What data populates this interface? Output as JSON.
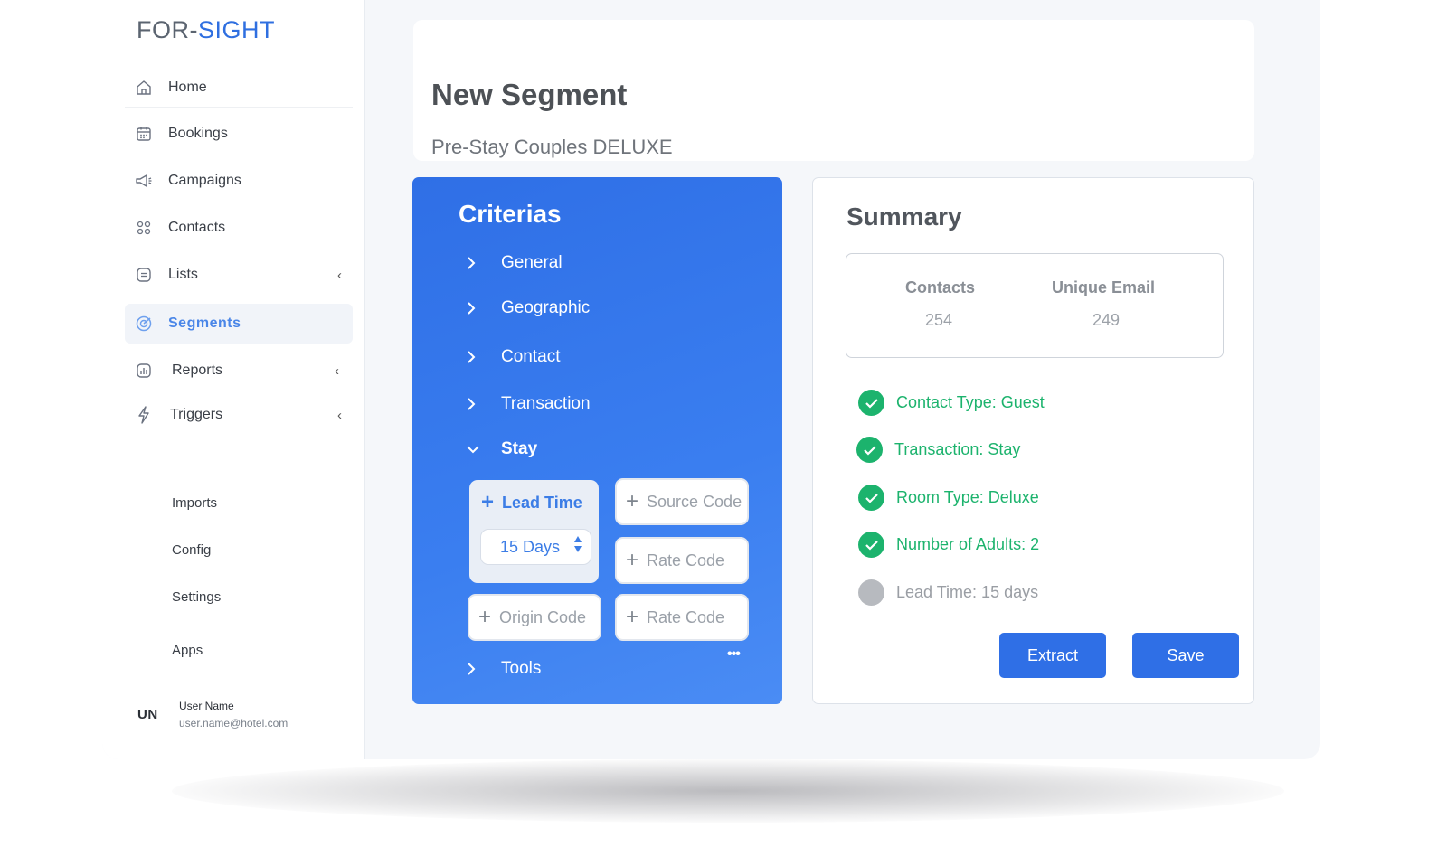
{
  "app": {
    "logo": {
      "part1": "FOR",
      "part2": "SIGHT"
    }
  },
  "sidebar": {
    "items": [
      {
        "label": "Home",
        "icon": "home-icon"
      },
      {
        "label": "Bookings",
        "icon": "calendar-icon"
      },
      {
        "label": "Campaigns",
        "icon": "megaphone-icon"
      },
      {
        "label": "Contacts",
        "icon": "people-icon"
      },
      {
        "label": "Lists",
        "icon": "list-icon",
        "caret": "‹"
      },
      {
        "label": "Segments",
        "icon": "target-icon",
        "active": true
      },
      {
        "label": "Reports",
        "icon": "chart-icon",
        "caret": "‹"
      },
      {
        "label": "Triggers",
        "icon": "lightning-icon",
        "caret": "‹"
      }
    ],
    "secondary": [
      "Imports",
      "Config",
      "Settings",
      "Apps"
    ],
    "user": {
      "initials": "UN",
      "name": "User Name",
      "email": "user.name@hotel.com"
    }
  },
  "header": {
    "title": "New Segment",
    "subtitle": "Pre-Stay Couples DELUXE"
  },
  "criterias": {
    "title": "Criterias",
    "sections": [
      {
        "label": "General",
        "expanded": false
      },
      {
        "label": "Geographic",
        "expanded": false
      },
      {
        "label": "Contact",
        "expanded": false
      },
      {
        "label": "Transaction",
        "expanded": false
      },
      {
        "label": "Stay",
        "expanded": true
      },
      {
        "label": "Tools",
        "expanded": false
      }
    ],
    "stay": {
      "lead_time_label": "Lead Time",
      "lead_time_value": "15 Days",
      "source_code": "Source Code",
      "rate_code_1": "Rate Code",
      "origin_code": "Origin Code",
      "rate_code_2": "Rate Code",
      "more": "•••"
    }
  },
  "summary": {
    "title": "Summary",
    "stats": {
      "contacts_label": "Contacts",
      "contacts_value": "254",
      "unique_email_label": "Unique Email",
      "unique_email_value": "249"
    },
    "criteria": [
      {
        "text": "Contact Type: Guest",
        "status": "ok"
      },
      {
        "text": "Transaction: Stay",
        "status": "ok"
      },
      {
        "text": "Room Type: Deluxe",
        "status": "ok"
      },
      {
        "text": "Number of Adults: 2",
        "status": "ok"
      },
      {
        "text": "Lead Time: 15 days",
        "status": "pending"
      }
    ],
    "buttons": {
      "extract": "Extract",
      "save": "Save"
    }
  },
  "colors": {
    "accent": "#2f6fe6",
    "success": "#1cb36d",
    "pending": "#b7babf",
    "active_nav": "#4a86e8"
  }
}
